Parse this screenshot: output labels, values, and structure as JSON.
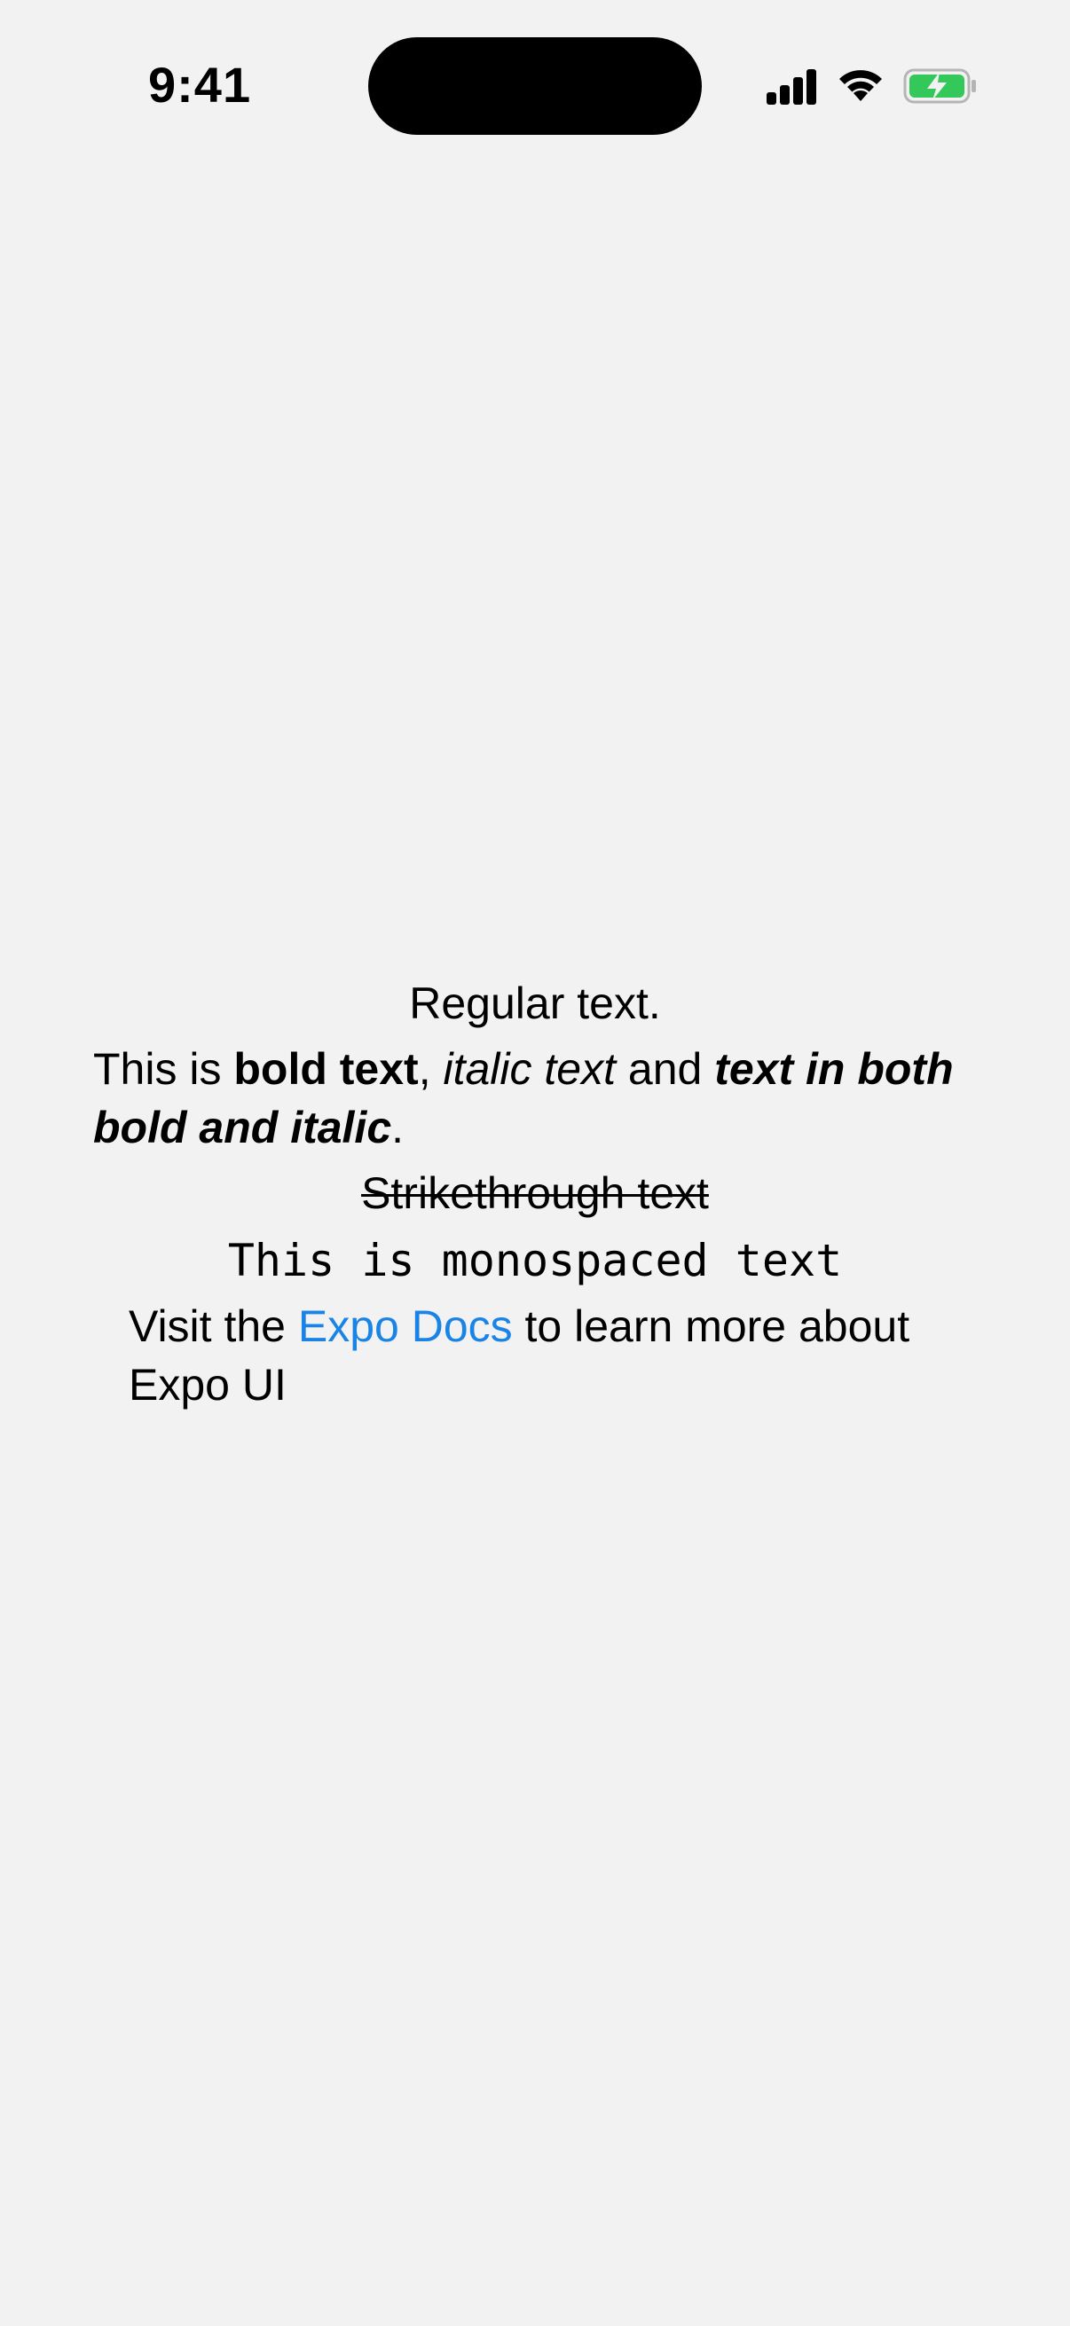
{
  "status_bar": {
    "time": "9:41",
    "icons": {
      "signal": "cellular-signal-icon",
      "wifi": "wifi-icon",
      "battery": "battery-charging-icon"
    },
    "colors": {
      "battery_fill": "#34c759",
      "island": "#000000"
    }
  },
  "content": {
    "regular_text": "Regular text.",
    "rich": {
      "prefix": "This is ",
      "bold": "bold text",
      "comma": ", ",
      "italic": "italic text",
      "and": " and ",
      "bold_italic": "text in both bold and italic",
      "period": "."
    },
    "strikethrough": "Strikethrough text",
    "monospace": "This is monospaced text",
    "link_para": {
      "prefix": "Visit the ",
      "link_text": "Expo Docs",
      "suffix": " to learn more about Expo UI"
    },
    "colors": {
      "link": "#1a84e6",
      "background": "#f2f2f2"
    }
  }
}
